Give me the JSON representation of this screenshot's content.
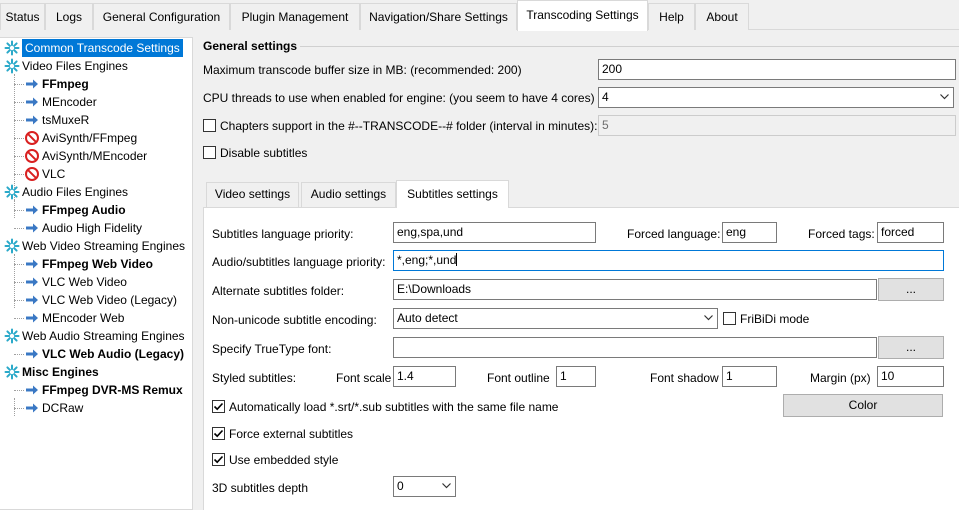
{
  "tabs": [
    "Status",
    "Logs",
    "General Configuration",
    "Plugin Management",
    "Navigation/Share Settings",
    "Transcoding Settings",
    "Help",
    "About"
  ],
  "active_tab": "Transcoding Settings",
  "tree": {
    "items": [
      {
        "label": "Common Transcode Settings",
        "icon": "gear-icon",
        "selected": true
      },
      {
        "label": "Video Files Engines",
        "icon": "gear-icon"
      },
      {
        "label": "FFmpeg",
        "icon": "arrow-right-icon",
        "bold": true
      },
      {
        "label": "MEncoder",
        "icon": "arrow-right-icon"
      },
      {
        "label": "tsMuxeR",
        "icon": "arrow-right-icon"
      },
      {
        "label": "AviSynth/FFmpeg",
        "icon": "disabled-icon"
      },
      {
        "label": "AviSynth/MEncoder",
        "icon": "disabled-icon"
      },
      {
        "label": "VLC",
        "icon": "disabled-icon"
      },
      {
        "label": "Audio Files Engines",
        "icon": "gear-icon"
      },
      {
        "label": "FFmpeg Audio",
        "icon": "arrow-right-icon",
        "bold": true
      },
      {
        "label": "Audio High Fidelity",
        "icon": "arrow-right-icon"
      },
      {
        "label": "Web Video Streaming Engines",
        "icon": "gear-icon"
      },
      {
        "label": "FFmpeg Web Video",
        "icon": "arrow-right-icon",
        "bold": true
      },
      {
        "label": "VLC Web Video",
        "icon": "arrow-right-icon"
      },
      {
        "label": "VLC Web Video (Legacy)",
        "icon": "arrow-right-icon"
      },
      {
        "label": "MEncoder Web",
        "icon": "arrow-right-icon"
      },
      {
        "label": "Web Audio Streaming Engines",
        "icon": "gear-icon"
      },
      {
        "label": "VLC Web Audio (Legacy)",
        "icon": "arrow-right-icon",
        "bold": true
      },
      {
        "label": "Misc Engines",
        "icon": "gear-icon",
        "bold": true
      },
      {
        "label": "FFmpeg DVR-MS Remux",
        "icon": "arrow-right-icon",
        "bold": true
      },
      {
        "label": "DCRaw",
        "icon": "arrow-right-icon"
      }
    ]
  },
  "general": {
    "heading": "General settings",
    "buffer_label": "Maximum transcode buffer size in MB: (recommended: 200)",
    "buffer_value": "200",
    "cpu_label": "CPU threads to use when enabled for engine: (you seem to have 4 cores)",
    "cpu_value": "4",
    "chapters_label": "Chapters support in the #--TRANSCODE--# folder (interval in minutes):",
    "chapters_value": "5",
    "chapters_checked": false,
    "disable_subs_label": "Disable subtitles",
    "disable_subs_checked": false
  },
  "inner_tabs": [
    "Video settings",
    "Audio settings",
    "Subtitles settings"
  ],
  "inner_active": "Subtitles settings",
  "subs": {
    "lang_priority_label": "Subtitles language priority:",
    "lang_priority_value": "eng,spa,und",
    "forced_lang_label": "Forced language:",
    "forced_lang_value": "eng",
    "forced_tags_label": "Forced tags:",
    "forced_tags_value": "forced",
    "audio_subs_label": "Audio/subtitles language priority:",
    "audio_subs_value": "*,eng;*,und",
    "alt_folder_label": "Alternate subtitles folder:",
    "alt_folder_value": "E:\\Downloads",
    "browse_label": "...",
    "encoding_label": "Non-unicode subtitle encoding:",
    "encoding_value": "Auto detect",
    "fribidi_label": "FriBiDi mode",
    "fribidi_checked": false,
    "truetype_label": "Specify TrueType font:",
    "truetype_value": "",
    "styled_label": "Styled subtitles:",
    "font_scale_label": "Font scale",
    "font_scale_value": "1.4",
    "font_outline_label": "Font outline",
    "font_outline_value": "1",
    "font_shadow_label": "Font shadow",
    "font_shadow_value": "1",
    "margin_label": "Margin (px)",
    "margin_value": "10",
    "autoload_label": "Automatically load *.srt/*.sub subtitles with the same file name",
    "autoload_checked": true,
    "color_label": "Color",
    "force_external_label": "Force external subtitles",
    "force_external_checked": true,
    "embedded_label": "Use embedded style",
    "embedded_checked": true,
    "depth_label": "3D subtitles depth",
    "depth_value": "0"
  },
  "colors": {
    "selection": "#0078d7",
    "disabled_icon": "#d92020",
    "arrow_icon": "#3a78c4"
  }
}
